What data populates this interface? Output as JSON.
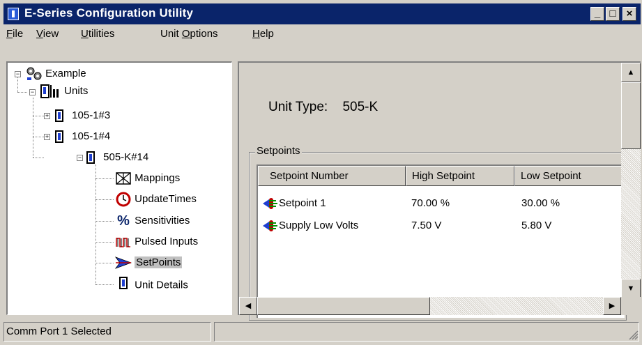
{
  "window": {
    "title": "E-Series Configuration Utility",
    "controls": {
      "minimize": "_",
      "maximize": "□",
      "close": "×"
    }
  },
  "menubar": {
    "items": [
      {
        "label_first": "F",
        "label_rest": "ile"
      },
      {
        "label_first": "V",
        "label_rest": "iew"
      },
      {
        "label_first": "U",
        "label_rest": "tilities"
      },
      {
        "label_pre": "Unit ",
        "label_first": "O",
        "label_rest": "ptions"
      },
      {
        "label_first": "H",
        "label_rest": "elp"
      }
    ]
  },
  "tree": {
    "root": {
      "label": "Example",
      "icon": "network-icon"
    },
    "units": {
      "label": "Units",
      "icon": "units-icon"
    },
    "unit_items": [
      {
        "label": "105-1#3",
        "expander": "+"
      },
      {
        "label": "105-1#4",
        "expander": "+"
      },
      {
        "label": "505-K#14",
        "expander": "−"
      }
    ],
    "sub_items": [
      {
        "label": "Mappings",
        "icon": "mappings-icon"
      },
      {
        "label": "UpdateTimes",
        "icon": "clock-icon"
      },
      {
        "label": "Sensitivities",
        "icon": "percent-icon"
      },
      {
        "label": "Pulsed Inputs",
        "icon": "pulse-icon"
      },
      {
        "label": "SetPoints",
        "icon": "setpoint-arrow-icon"
      },
      {
        "label": "Unit Details",
        "icon": "unit-icon"
      }
    ]
  },
  "detail": {
    "unit_type_label": "Unit Type:",
    "unit_type_value": "505-K",
    "setpoints_group": "Setpoints",
    "columns": [
      "Setpoint Number",
      "High Setpoint",
      "Low Setpoint"
    ],
    "rows": [
      {
        "name": "Setpoint 1",
        "high": "70.00 %",
        "low": "30.00 %"
      },
      {
        "name": "Supply Low Volts",
        "high": "7.50 V",
        "low": "5.80 V"
      }
    ]
  },
  "status": {
    "text": "Comm Port 1 Selected"
  },
  "colors": {
    "title_bar": "#0a246a",
    "face": "#d4d0c8",
    "selection": "#c0c0c0"
  }
}
